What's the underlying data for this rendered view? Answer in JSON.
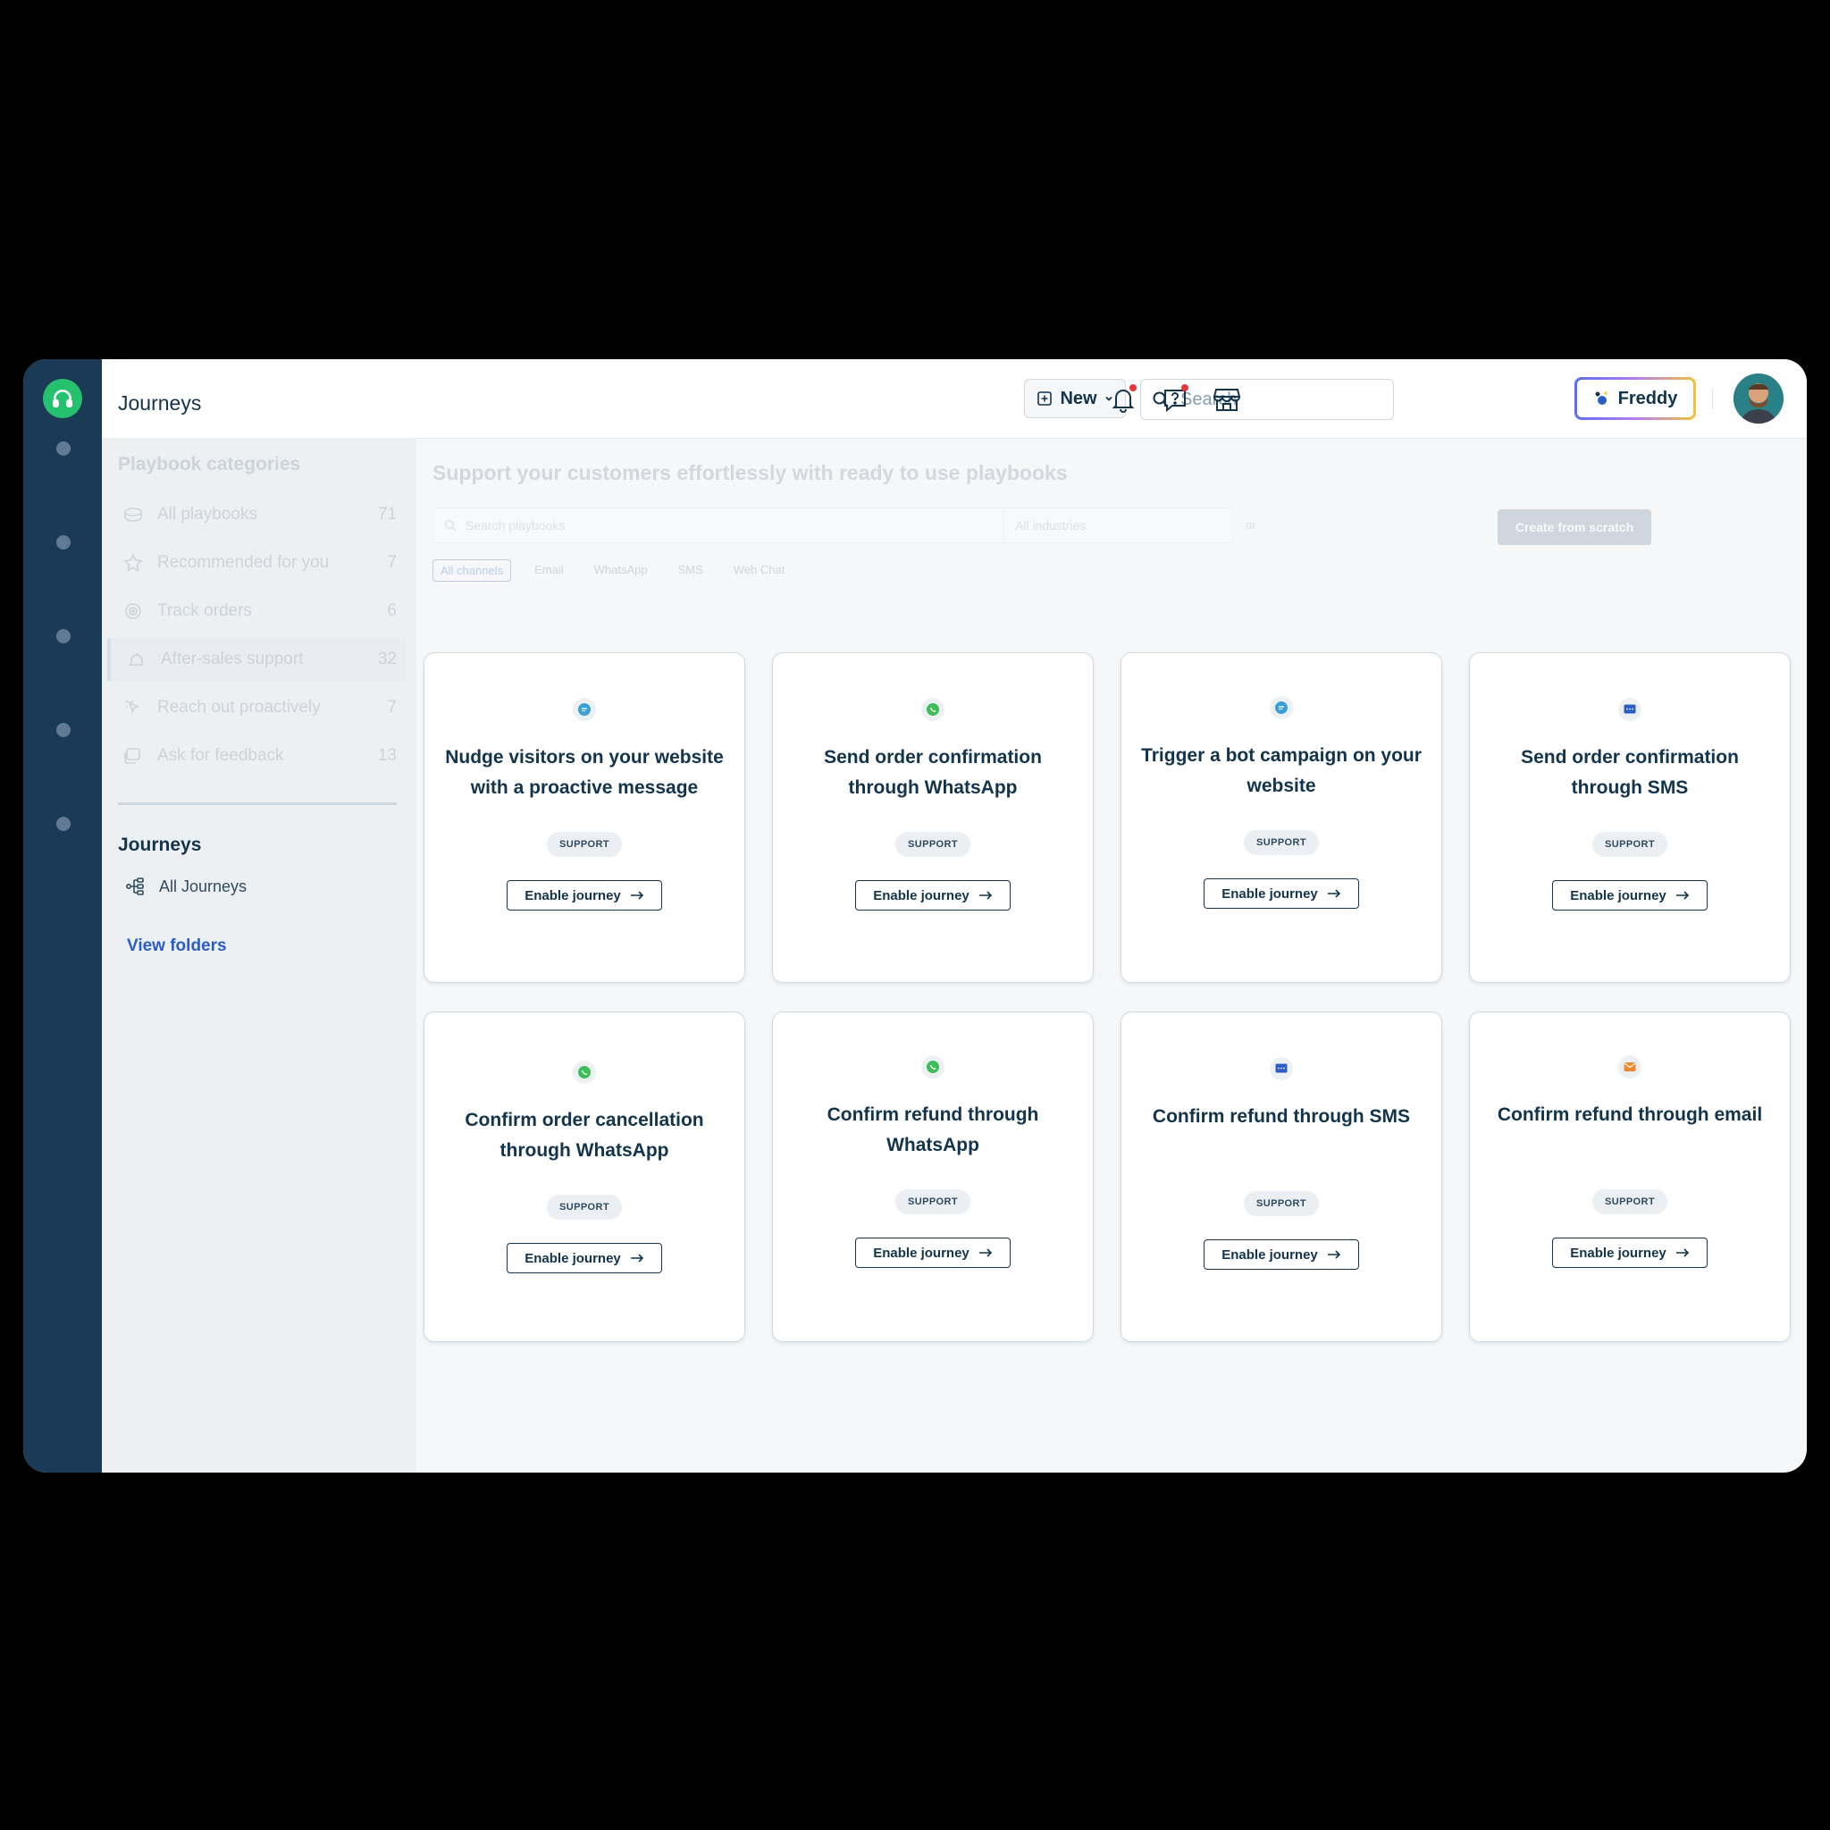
{
  "topbar": {
    "title": "Journeys",
    "new_label": "New",
    "search_placeholder": "Search",
    "freddy_label": "Freddy"
  },
  "sidebar": {
    "categories_title": "Playbook categories",
    "categories": [
      {
        "label": "All playbooks",
        "count": "71",
        "icon": "playbooks-icon"
      },
      {
        "label": "Recommended for you",
        "count": "7",
        "icon": "star-icon"
      },
      {
        "label": "Track orders",
        "count": "6",
        "icon": "target-icon"
      },
      {
        "label": "After-sales support",
        "count": "32",
        "icon": "support-icon",
        "active": true
      },
      {
        "label": "Reach out proactively",
        "count": "7",
        "icon": "cursor-icon"
      },
      {
        "label": "Ask for feedback",
        "count": "13",
        "icon": "feedback-icon"
      }
    ],
    "journeys_title": "Journeys",
    "all_journeys": "All Journeys",
    "view_folders": "View folders"
  },
  "main": {
    "header": "Support your customers effortlessly with ready to use playbooks",
    "search_placeholder": "Search playbooks",
    "industries": "All industries",
    "or": "or",
    "create_scratch": "Create from scratch",
    "channels": [
      "All channels",
      "Email",
      "WhatsApp",
      "SMS",
      "Web Chat"
    ]
  },
  "cards": [
    {
      "title": "Nudge visitors on your website with a proactive message",
      "tag": "SUPPORT",
      "button": "Enable journey",
      "icon": "chat-icon",
      "icon_color": "#3aa0d8"
    },
    {
      "title": "Send order confirmation through WhatsApp",
      "tag": "SUPPORT",
      "button": "Enable journey",
      "icon": "whatsapp-icon",
      "icon_color": "#3fbd5a"
    },
    {
      "title": "Trigger a bot campaign on your website",
      "tag": "SUPPORT",
      "button": "Enable journey",
      "icon": "chat-icon",
      "icon_color": "#3aa0d8"
    },
    {
      "title": "Send order confirmation through SMS",
      "tag": "SUPPORT",
      "button": "Enable journey",
      "icon": "sms-icon",
      "icon_color": "#2c5cc5"
    },
    {
      "title": "Confirm order cancellation through WhatsApp",
      "tag": "SUPPORT",
      "button": "Enable journey",
      "icon": "whatsapp-icon",
      "icon_color": "#3fbd5a"
    },
    {
      "title": "Confirm refund through WhatsApp",
      "tag": "SUPPORT",
      "button": "Enable journey",
      "icon": "whatsapp-icon",
      "icon_color": "#3fbd5a"
    },
    {
      "title": "Confirm refund through SMS",
      "tag": "SUPPORT",
      "button": "Enable journey",
      "icon": "sms-icon",
      "icon_color": "#2c5cc5"
    },
    {
      "title": "Confirm refund through email",
      "tag": "SUPPORT",
      "button": "Enable journey",
      "icon": "email-icon",
      "icon_color": "#f08a30"
    }
  ],
  "colors": {
    "rail": "#1a3a55",
    "brand_green": "#25c16f",
    "link_blue": "#2c5cc5"
  }
}
